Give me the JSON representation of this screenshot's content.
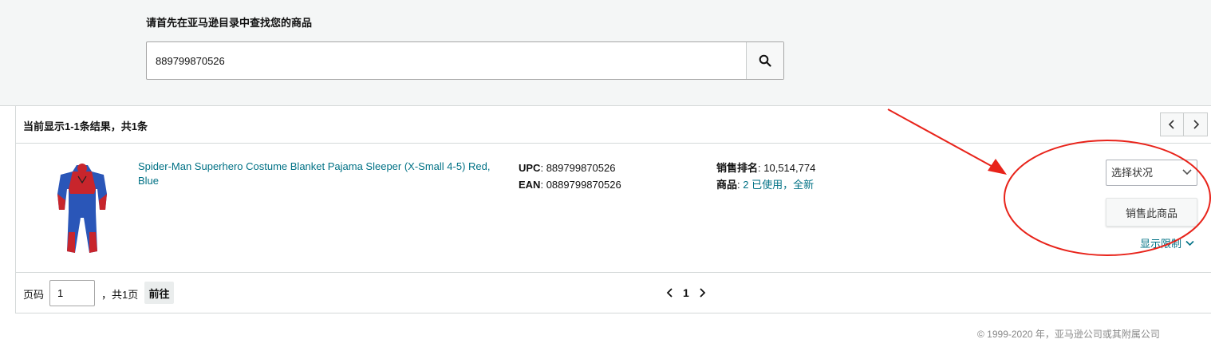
{
  "search": {
    "title": "请首先在亚马逊目录中查找您的商品",
    "value": "889799870526",
    "icon": "search-icon"
  },
  "results": {
    "count_text": "当前显示1-1条结果，共1条",
    "prev_icon": "chevron-left-icon",
    "next_icon": "chevron-right-icon"
  },
  "product": {
    "title": "Spider-Man Superhero Costume Blanket Pajama Sleeper (X-Small 4-5) Red, Blue",
    "upc_label": "UPC",
    "upc": "889799870526",
    "ean_label": "EAN",
    "ean": "0889799870526",
    "rank_label": "销售排名",
    "rank": "10,514,774",
    "offers_label": "商品",
    "offers_link": "2 已使用，全新",
    "condition_select": "选择状况",
    "sell_button": "销售此商品",
    "limits_link": "显示限制"
  },
  "pagination": {
    "page_label": "页码",
    "page_value": "1",
    "total": "，共1页",
    "go": "前往",
    "current": "1"
  },
  "footer": {
    "copyright": "© 1999-2020 年，亚马逊公司或其附属公司"
  },
  "colors": {
    "link": "#007185",
    "annotation": "#e8231a",
    "band": "#f4f6f6"
  }
}
